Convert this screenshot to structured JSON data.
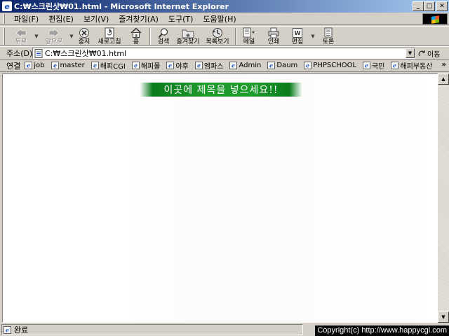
{
  "window": {
    "title": "C:₩스크린샷₩01.html - Microsoft Internet Explorer",
    "app_icon": "ie-icon"
  },
  "menu": [
    "파일(F)",
    "편집(E)",
    "보기(V)",
    "즐겨찾기(A)",
    "도구(T)",
    "도움말(H)"
  ],
  "toolbar": {
    "back": "뒤로",
    "forward": "앞으로",
    "stop": "중지",
    "refresh": "새로고침",
    "home": "홈",
    "search": "검색",
    "favorites": "즐겨찾기",
    "history": "목록보기",
    "mail": "메일",
    "print": "인쇄",
    "edit": "편집",
    "discuss": "토론"
  },
  "address": {
    "label": "주소(D)",
    "value": "C:₩스크린샷₩01.html",
    "go_label": "이동"
  },
  "links": {
    "label": "연결",
    "items": [
      "job",
      "master",
      "해피CGI",
      "해피몰",
      "야후",
      "엠파스",
      "Admin",
      "Daum",
      "PHPSCHOOL",
      "국민",
      "해피부동산"
    ]
  },
  "page": {
    "banner_text": "이곳에 제목을 넣으세요!!",
    "banner_color": "#1f9a2e"
  },
  "status": {
    "text": "완료",
    "copyright": "Copyright(c) http://www.happycgi.com"
  }
}
